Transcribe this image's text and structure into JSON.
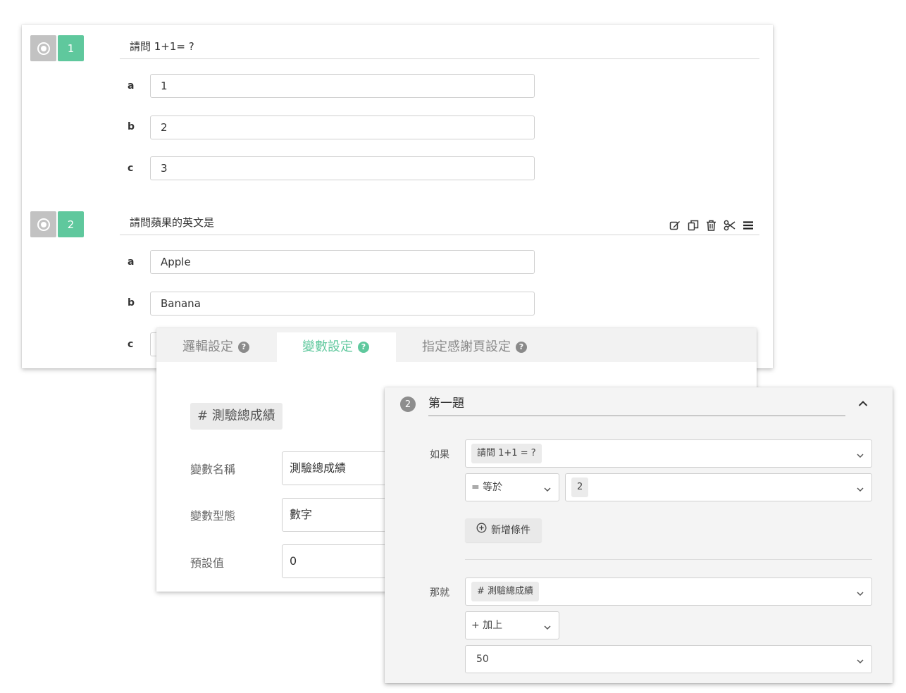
{
  "questions": [
    {
      "number": "1",
      "title": "請問 1+1= ?",
      "options": [
        {
          "key": "a",
          "value": "1"
        },
        {
          "key": "b",
          "value": "2"
        },
        {
          "key": "c",
          "value": "3"
        }
      ]
    },
    {
      "number": "2",
      "title": "請問蘋果的英文是",
      "options": [
        {
          "key": "a",
          "value": "Apple"
        },
        {
          "key": "b",
          "value": "Banana"
        },
        {
          "key": "c",
          "value": ""
        }
      ]
    }
  ],
  "toolbar_icons": [
    "edit-icon",
    "copy-icon",
    "trash-icon",
    "scissors-icon",
    "menu-icon"
  ],
  "settings": {
    "tabs": [
      {
        "label": "邏輯設定",
        "active": false
      },
      {
        "label": "變數設定",
        "active": true
      },
      {
        "label": "指定感謝頁設定",
        "active": false
      }
    ],
    "variable_chip": "# 測驗總成績",
    "fields": [
      {
        "label": "變數名稱",
        "value": "測驗總成績"
      },
      {
        "label": "變數型態",
        "value": "數字"
      },
      {
        "label": "預設值",
        "value": "0"
      }
    ]
  },
  "logic": {
    "step": "2",
    "title": "第一題",
    "if_label": "如果",
    "if_question": "請問 1+1 = ?",
    "operator": "= 等於",
    "compare_value": "2",
    "add_condition": "新增條件",
    "then_label": "那就",
    "then_variable": "# 測驗總成績",
    "action": "+ 加上",
    "action_value": "50"
  },
  "colors": {
    "accent": "#5fc89d",
    "badge_gray": "#c2c2c2"
  }
}
